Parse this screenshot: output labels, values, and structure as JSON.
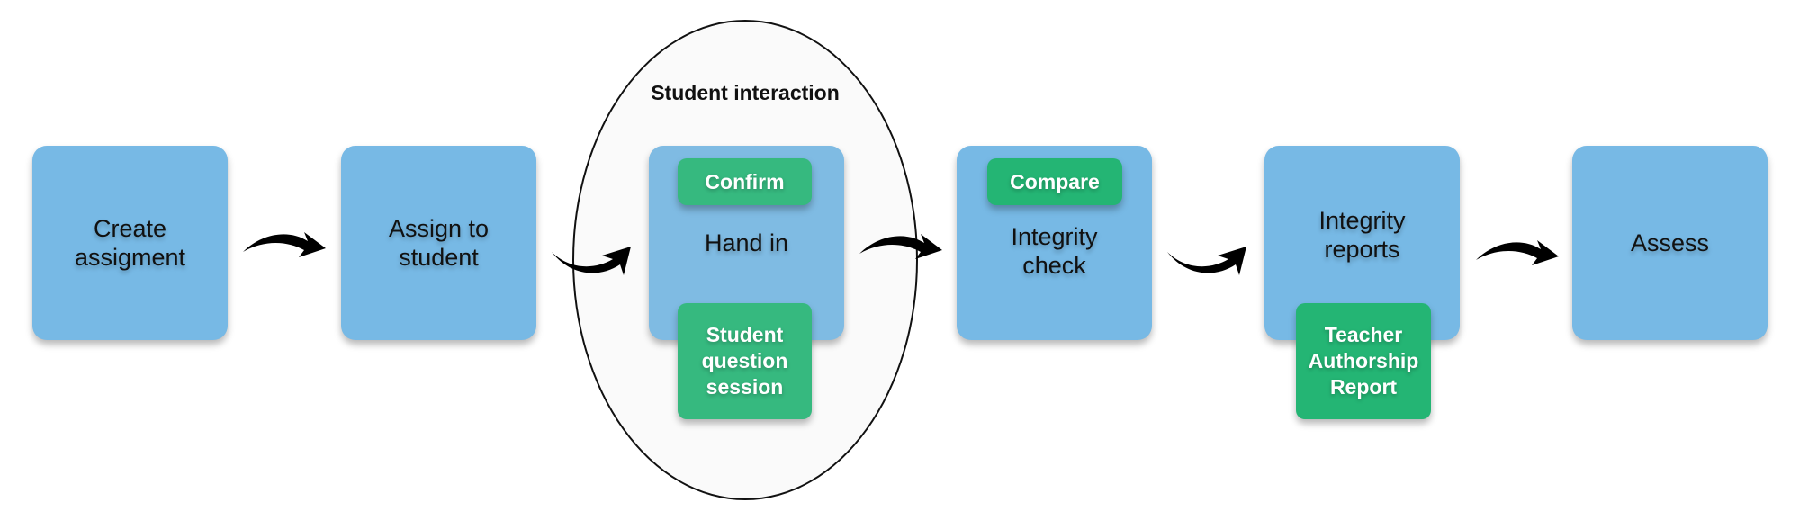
{
  "colors": {
    "step_box": "#77b9e5",
    "sub_step": "#24b574",
    "arrow": "#000000",
    "group_fill": "#fafafa"
  },
  "group": {
    "title": "Student interaction"
  },
  "steps": [
    {
      "label": "Create\nassigment"
    },
    {
      "label": "Assign to\nstudent"
    },
    {
      "label": "Hand in"
    },
    {
      "label": "Integrity\ncheck"
    },
    {
      "label": "Integrity\nreports"
    },
    {
      "label": "Assess"
    }
  ],
  "sub_steps": {
    "confirm": "Confirm",
    "student_question_session": "Student\nquestion\nsession",
    "compare": "Compare",
    "teacher_authorship_report": "Teacher\nAuthorship\nReport"
  },
  "arrows": [
    {
      "from": "Create assigment",
      "to": "Assign to student",
      "icon": "curved-arrow-icon"
    },
    {
      "from": "Assign to student",
      "to": "Hand in",
      "icon": "curved-arrow-icon"
    },
    {
      "from": "Hand in",
      "to": "Integrity check",
      "icon": "curved-arrow-icon"
    },
    {
      "from": "Integrity check",
      "to": "Integrity reports",
      "icon": "curved-arrow-icon"
    },
    {
      "from": "Integrity reports",
      "to": "Assess",
      "icon": "curved-arrow-icon"
    }
  ]
}
